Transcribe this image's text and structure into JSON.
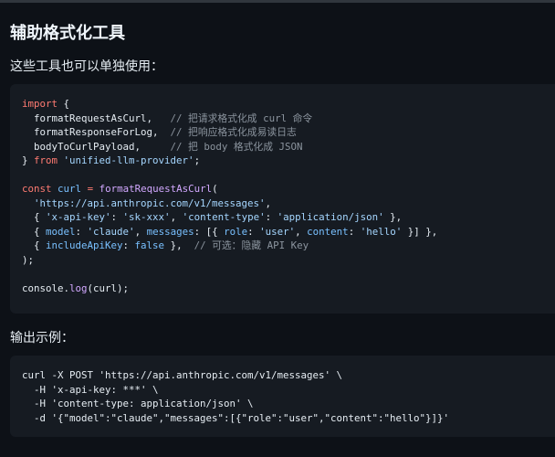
{
  "section": {
    "heading": "辅助格式化工具",
    "intro": "这些工具也可以单独使用：",
    "output_label": "输出示例："
  },
  "code_example": {
    "language": "javascript",
    "lines": [
      "import {",
      "  formatRequestAsCurl,   // 把请求格式化成 curl 命令",
      "  formatResponseForLog,  // 把响应格式化成易读日志",
      "  bodyToCurlPayload,     // 把 body 格式化成 JSON",
      "} from 'unified-llm-provider';",
      "",
      "const curl = formatRequestAsCurl(",
      "  'https://api.anthropic.com/v1/messages',",
      "  { 'x-api-key': 'sk-xxx', 'content-type': 'application/json' },",
      "  { model: 'claude', messages: [{ role: 'user', content: 'hello' }] },",
      "  { includeApiKey: false },  // 可选：隐藏 API Key",
      ");",
      "",
      "console.log(curl);"
    ]
  },
  "output_example": {
    "language": "shell",
    "lines": [
      "curl -X POST 'https://api.anthropic.com/v1/messages' \\",
      "  -H 'x-api-key: ***' \\",
      "  -H 'content-type: application/json' \\",
      "  -d '{\"model\":\"claude\",\"messages\":[{\"role\":\"user\",\"content\":\"hello\"}]}'"
    ]
  },
  "colors": {
    "background": "#0d1117",
    "code_background": "#161b22",
    "keyword": "#ff7b72",
    "function": "#d2a8ff",
    "string": "#a5d6ff",
    "comment": "#8b949e",
    "property": "#79c0ff"
  }
}
